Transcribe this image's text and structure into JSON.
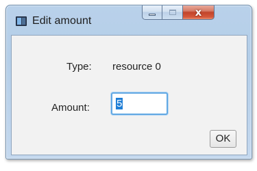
{
  "window": {
    "title": "Edit amount",
    "icon": "app-window-icon",
    "close_glyph": "x"
  },
  "form": {
    "type_label": "Type:",
    "type_value": "resource 0",
    "amount_label": "Amount:",
    "amount_value": "5"
  },
  "buttons": {
    "ok_label": "OK"
  },
  "colors": {
    "selection": "#1f7ed6",
    "input_focus_border": "#62a8e3",
    "close_button": "#c1442b"
  }
}
